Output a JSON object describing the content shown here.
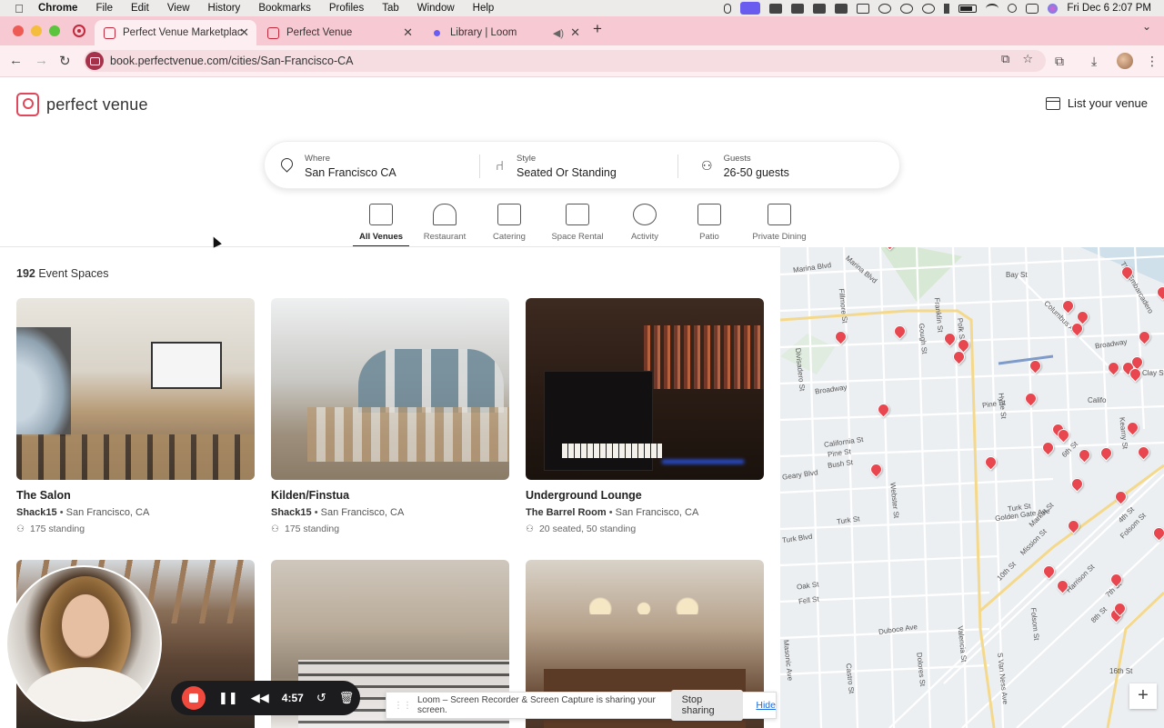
{
  "menubar": {
    "apple": "",
    "items": [
      "Chrome",
      "File",
      "Edit",
      "View",
      "History",
      "Bookmarks",
      "Profiles",
      "Tab",
      "Window",
      "Help"
    ],
    "datetime": "Fri Dec 6  2:07 PM"
  },
  "browser": {
    "tabs": [
      {
        "title": "Perfect Venue Marketplac",
        "active": true
      },
      {
        "title": "Perfect Venue",
        "active": false
      },
      {
        "title": "Library | Loom",
        "active": false
      }
    ],
    "url": "book.perfectvenue.com/cities/San-Francisco-CA"
  },
  "header": {
    "logo_text": "perfect venue",
    "list_venue": "List your venue"
  },
  "search": {
    "where_label": "Where",
    "where_value": "San Francisco CA",
    "style_label": "Style",
    "style_value": "Seated Or Standing",
    "guests_label": "Guests",
    "guests_value": "26-50 guests"
  },
  "categories": [
    {
      "label": "All Venues",
      "active": true
    },
    {
      "label": "Restaurant",
      "active": false
    },
    {
      "label": "Catering",
      "active": false
    },
    {
      "label": "Space Rental",
      "active": false
    },
    {
      "label": "Activity",
      "active": false
    },
    {
      "label": "Patio",
      "active": false
    },
    {
      "label": "Private Dining",
      "active": false
    }
  ],
  "results": {
    "count": "192",
    "count_suffix": "Event Spaces",
    "venues": [
      {
        "title": "The Salon",
        "host": "Shack15",
        "city": "San Francisco, CA",
        "capacity": "175 standing"
      },
      {
        "title": "Kilden/Finstua",
        "host": "Shack15",
        "city": "San Francisco, CA",
        "capacity": "175 standing"
      },
      {
        "title": "Underground Lounge",
        "host": "The Barrel Room",
        "city": "San Francisco, CA",
        "capacity": "20 seated, 50 standing"
      }
    ]
  },
  "map": {
    "labels": [
      "Marina Blvd",
      "Marina Blvd",
      "Bay St",
      "Fillmore St",
      "Gough St",
      "Franklin St",
      "Polk St",
      "Columbus Ave",
      "The Embarcadero",
      "Broadway",
      "Broadway",
      "Divisadero St",
      "Clay St",
      "Hyde St",
      "Pine St",
      "California St",
      "Pine St",
      "Bush St",
      "Geary Blvd",
      "Webster St",
      "Turk St",
      "Golden Gate Ave",
      "Turk St",
      "Turk Blvd",
      "Market St",
      "Mission St",
      "10th St",
      "Oak St",
      "Fell St",
      "Duboce Ave",
      "Valencia St",
      "Folsom St",
      "Harrison St",
      "Dolores St",
      "Castro St",
      "S Van Ness Ave",
      "16th St",
      "Masonic Ave",
      "Kearny St",
      "Califo",
      "4th St",
      "6th St",
      "7th St",
      "8th St",
      "Folsom St"
    ],
    "zoom_in": "+"
  },
  "loom": {
    "timer": "4:57",
    "share_text": "Loom – Screen Recorder & Screen Capture is sharing your screen.",
    "stop_sharing": "Stop sharing",
    "hide": "Hide"
  },
  "colors": {
    "brand": "#e0475a",
    "pin": "#e8474f",
    "tabstrip": "#f7c9d2"
  }
}
